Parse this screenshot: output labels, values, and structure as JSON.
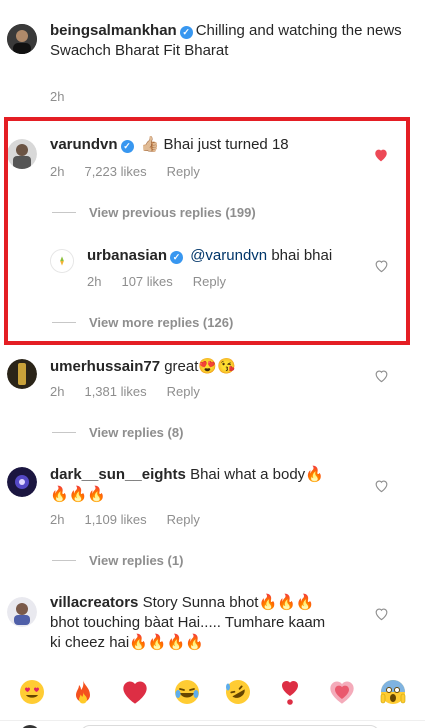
{
  "caption": {
    "username": "beingsalmankhan",
    "text": "Chilling and watching the news",
    "text2": "Swachch Bharat Fit Bharat",
    "time": "2h"
  },
  "comments": [
    {
      "username": "varundvn",
      "verified": true,
      "text": "Bhai just turned 18",
      "time": "2h",
      "likes": "7,223 likes",
      "reply": "Reply",
      "liked": true,
      "view_replies": "View previous replies (199)"
    },
    {
      "username": "urbanasian",
      "verified": true,
      "mention": "@varundvn",
      "text": "bhai bhai",
      "time": "2h",
      "likes": "107 likes",
      "reply": "Reply",
      "liked": false,
      "view_replies": "View more replies (126)"
    },
    {
      "username": "umerhussain77",
      "text": "great",
      "time": "2h",
      "likes": "1,381 likes",
      "reply": "Reply",
      "liked": false,
      "view_replies": "View replies (8)"
    },
    {
      "username": "dark__sun__eights",
      "text": "Bhai what a body",
      "time": "2h",
      "likes": "1,109 likes",
      "reply": "Reply",
      "liked": false,
      "view_replies": "View replies (1)"
    },
    {
      "username": "villacreators",
      "text1": "Story Sunna bhot",
      "text2": "bhot touching bàat Hai..... Tumhare kaam",
      "text3": "ki cheez hai",
      "liked": false
    }
  ],
  "emoji_bar": [
    "heart-eyes",
    "fire",
    "red-heart",
    "tears-of-joy",
    "rofl",
    "heart-exclamation",
    "growing-heart",
    "screaming-face"
  ],
  "colors": {
    "highlight": "#e41e24",
    "liked_heart": "#ed4956",
    "verified": "#3897f0",
    "meta": "#8e8e8e"
  }
}
